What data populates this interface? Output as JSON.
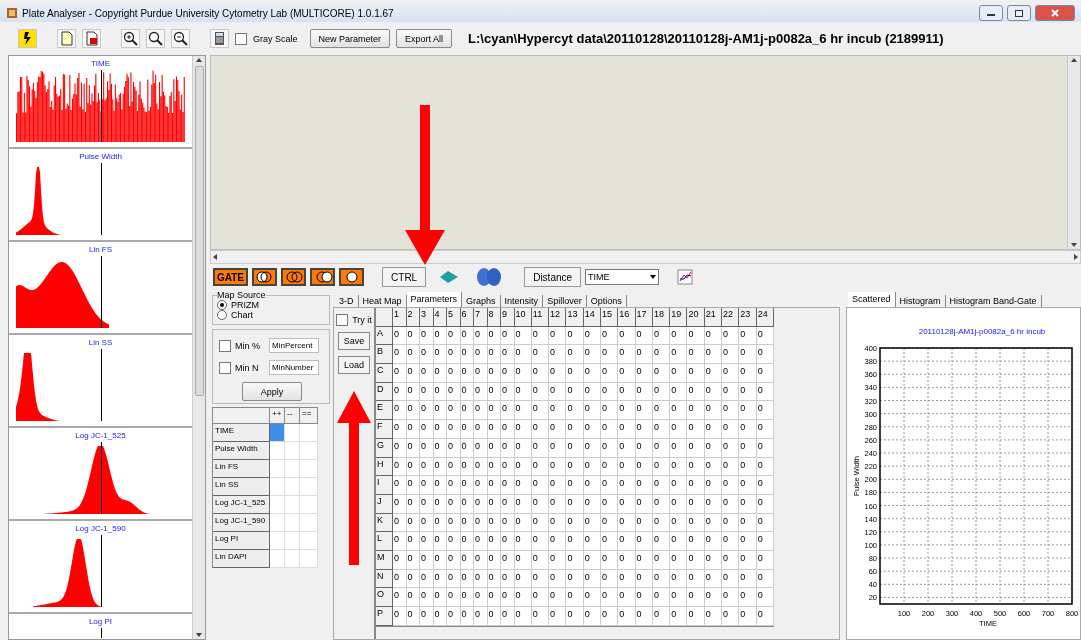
{
  "window": {
    "title": "Plate Analyser - Copyright Purdue University Cytometry Lab (MULTICORE) 1.0.1.67"
  },
  "toolbar": {
    "gray_scale": {
      "label": "Gray Scale",
      "checked": false
    },
    "buttons": [
      "New Parameter",
      "Export All"
    ],
    "path": "L:\\cyan\\Hypercyt data\\20110128\\20110128j-AM1j-p0082a_6 hr incub (2189911)"
  },
  "histograms": [
    {
      "title": "TIME"
    },
    {
      "title": "Pulse Width"
    },
    {
      "title": "Lin FS"
    },
    {
      "title": "Lin SS"
    },
    {
      "title": "Log JC-1_525"
    },
    {
      "title": "Log JC-1_590"
    },
    {
      "title": "Log PI"
    }
  ],
  "gate_toolbar": {
    "gate": "GATE",
    "ctrl": "CTRL",
    "distance": "Distance",
    "axis_select": "TIME"
  },
  "map_source": {
    "title": "Map Source",
    "options": [
      {
        "label": "PRIZM",
        "selected": true
      },
      {
        "label": "Chart",
        "selected": false
      }
    ]
  },
  "filters": [
    {
      "label": "Min %",
      "checked": false,
      "value": "MinPercent"
    },
    {
      "label": "Min N",
      "checked": false,
      "value": "MinNumber"
    }
  ],
  "apply_button": "Apply",
  "gate_table": {
    "columns": [
      "++",
      "--",
      "=="
    ],
    "rows": [
      {
        "name": "TIME",
        "cells": [
          {
            "selected": true
          },
          {
            "selected": false
          },
          {
            "selected": false
          }
        ]
      },
      {
        "name": "Pulse Width",
        "cells": [
          {
            "selected": false
          },
          {
            "selected": false
          },
          {
            "selected": false
          }
        ]
      },
      {
        "name": "Lin FS",
        "cells": [
          {
            "selected": false
          },
          {
            "selected": false
          },
          {
            "selected": false
          }
        ]
      },
      {
        "name": "Lin SS",
        "cells": [
          {
            "selected": false
          },
          {
            "selected": false
          },
          {
            "selected": false
          }
        ]
      },
      {
        "name": "Log JC-1_525",
        "cells": [
          {
            "selected": false
          },
          {
            "selected": false
          },
          {
            "selected": false
          }
        ]
      },
      {
        "name": "Log JC-1_590",
        "cells": [
          {
            "selected": false
          },
          {
            "selected": false
          },
          {
            "selected": false
          }
        ]
      },
      {
        "name": "Log PI",
        "cells": [
          {
            "selected": false
          },
          {
            "selected": false
          },
          {
            "selected": false
          }
        ]
      },
      {
        "name": "Lin DAPI",
        "cells": [
          {
            "selected": false
          },
          {
            "selected": false
          },
          {
            "selected": false
          }
        ]
      }
    ]
  },
  "plate_tabs": [
    {
      "label": "3-D",
      "selected": false
    },
    {
      "label": "Heat Map",
      "selected": false
    },
    {
      "label": "Parameters",
      "selected": true
    },
    {
      "label": "Graphs",
      "selected": false
    },
    {
      "label": "Intensity",
      "selected": false
    },
    {
      "label": "Spillover",
      "selected": false
    },
    {
      "label": "Options",
      "selected": false
    }
  ],
  "try_it": {
    "label": "Try it",
    "checked": false
  },
  "plate_buttons": [
    "Save",
    "Load"
  ],
  "plate_grid": {
    "columns": [
      "1",
      "2",
      "3",
      "4",
      "5",
      "6",
      "7",
      "8",
      "9",
      "10",
      "11",
      "12",
      "13",
      "14",
      "15",
      "16",
      "17",
      "18",
      "19",
      "20",
      "21",
      "22",
      "23",
      "24"
    ],
    "rows": [
      {
        "label": "A",
        "values": [
          "0",
          "0",
          "0",
          "0",
          "0",
          "0",
          "0",
          "0",
          "0",
          "0",
          "0",
          "0",
          "0",
          "0",
          "0",
          "0",
          "0",
          "0",
          "0",
          "0",
          "0",
          "0",
          "0",
          "0"
        ]
      },
      {
        "label": "B",
        "values": [
          "0",
          "0",
          "0",
          "0",
          "0",
          "0",
          "0",
          "0",
          "0",
          "0",
          "0",
          "0",
          "0",
          "0",
          "0",
          "0",
          "0",
          "0",
          "0",
          "0",
          "0",
          "0",
          "0",
          "0"
        ]
      },
      {
        "label": "C",
        "values": [
          "0",
          "0",
          "0",
          "0",
          "0",
          "0",
          "0",
          "0",
          "0",
          "0",
          "0",
          "0",
          "0",
          "0",
          "0",
          "0",
          "0",
          "0",
          "0",
          "0",
          "0",
          "0",
          "0",
          "0"
        ]
      },
      {
        "label": "D",
        "values": [
          "0",
          "0",
          "0",
          "0",
          "0",
          "0",
          "0",
          "0",
          "0",
          "0",
          "0",
          "0",
          "0",
          "0",
          "0",
          "0",
          "0",
          "0",
          "0",
          "0",
          "0",
          "0",
          "0",
          "0"
        ]
      },
      {
        "label": "E",
        "values": [
          "0",
          "0",
          "0",
          "0",
          "0",
          "0",
          "0",
          "0",
          "0",
          "0",
          "0",
          "0",
          "0",
          "0",
          "0",
          "0",
          "0",
          "0",
          "0",
          "0",
          "0",
          "0",
          "0",
          "0"
        ]
      },
      {
        "label": "F",
        "values": [
          "0",
          "0",
          "0",
          "0",
          "0",
          "0",
          "0",
          "0",
          "0",
          "0",
          "0",
          "0",
          "0",
          "0",
          "0",
          "0",
          "0",
          "0",
          "0",
          "0",
          "0",
          "0",
          "0",
          "0"
        ]
      },
      {
        "label": "G",
        "values": [
          "0",
          "0",
          "0",
          "0",
          "0",
          "0",
          "0",
          "0",
          "0",
          "0",
          "0",
          "0",
          "0",
          "0",
          "0",
          "0",
          "0",
          "0",
          "0",
          "0",
          "0",
          "0",
          "0",
          "0"
        ]
      },
      {
        "label": "H",
        "values": [
          "0",
          "0",
          "0",
          "0",
          "0",
          "0",
          "0",
          "0",
          "0",
          "0",
          "0",
          "0",
          "0",
          "0",
          "0",
          "0",
          "0",
          "0",
          "0",
          "0",
          "0",
          "0",
          "0",
          "0"
        ]
      },
      {
        "label": "I",
        "values": [
          "0",
          "0",
          "0",
          "0",
          "0",
          "0",
          "0",
          "0",
          "0",
          "0",
          "0",
          "0",
          "0",
          "0",
          "0",
          "0",
          "0",
          "0",
          "0",
          "0",
          "0",
          "0",
          "0",
          "0"
        ]
      },
      {
        "label": "J",
        "values": [
          "0",
          "0",
          "0",
          "0",
          "0",
          "0",
          "0",
          "0",
          "0",
          "0",
          "0",
          "0",
          "0",
          "0",
          "0",
          "0",
          "0",
          "0",
          "0",
          "0",
          "0",
          "0",
          "0",
          "0"
        ]
      },
      {
        "label": "K",
        "values": [
          "0",
          "0",
          "0",
          "0",
          "0",
          "0",
          "0",
          "0",
          "0",
          "0",
          "0",
          "0",
          "0",
          "0",
          "0",
          "0",
          "0",
          "0",
          "0",
          "0",
          "0",
          "0",
          "0",
          "0"
        ]
      },
      {
        "label": "L",
        "values": [
          "0",
          "0",
          "0",
          "0",
          "0",
          "0",
          "0",
          "0",
          "0",
          "0",
          "0",
          "0",
          "0",
          "0",
          "0",
          "0",
          "0",
          "0",
          "0",
          "0",
          "0",
          "0",
          "0",
          "0"
        ]
      },
      {
        "label": "M",
        "values": [
          "0",
          "0",
          "0",
          "0",
          "0",
          "0",
          "0",
          "0",
          "0",
          "0",
          "0",
          "0",
          "0",
          "0",
          "0",
          "0",
          "0",
          "0",
          "0",
          "0",
          "0",
          "0",
          "0",
          "0"
        ]
      },
      {
        "label": "N",
        "values": [
          "0",
          "0",
          "0",
          "0",
          "0",
          "0",
          "0",
          "0",
          "0",
          "0",
          "0",
          "0",
          "0",
          "0",
          "0",
          "0",
          "0",
          "0",
          "0",
          "0",
          "0",
          "0",
          "0",
          "0"
        ]
      },
      {
        "label": "O",
        "values": [
          "0",
          "0",
          "0",
          "0",
          "0",
          "0",
          "0",
          "0",
          "0",
          "0",
          "0",
          "0",
          "0",
          "0",
          "0",
          "0",
          "0",
          "0",
          "0",
          "0",
          "0",
          "0",
          "0",
          "0"
        ]
      },
      {
        "label": "P",
        "values": [
          "0",
          "0",
          "0",
          "0",
          "0",
          "0",
          "0",
          "0",
          "0",
          "0",
          "0",
          "0",
          "0",
          "0",
          "0",
          "0",
          "0",
          "0",
          "0",
          "0",
          "0",
          "0",
          "0",
          "0"
        ]
      }
    ]
  },
  "chart_tabs": [
    {
      "label": "Scattered",
      "selected": true
    },
    {
      "label": "Histogram",
      "selected": false
    },
    {
      "label": "Histogram Band-Gate",
      "selected": false
    }
  ],
  "chart": {
    "chart_data": {
      "type": "scatter",
      "grid": true,
      "title": "20110128j-AM1j-p0082a_6 hr incub",
      "xlabel": "TIME",
      "ylabel": "Pulse Width",
      "xlim": [
        0,
        800
      ],
      "ylim": [
        10,
        400
      ],
      "xticks": [
        100,
        200,
        300,
        400,
        500,
        600,
        700,
        800
      ],
      "yticks": [
        20,
        40,
        60,
        80,
        100,
        120,
        140,
        160,
        180,
        200,
        220,
        240,
        260,
        280,
        300,
        320,
        340,
        360,
        380,
        400
      ]
    }
  }
}
